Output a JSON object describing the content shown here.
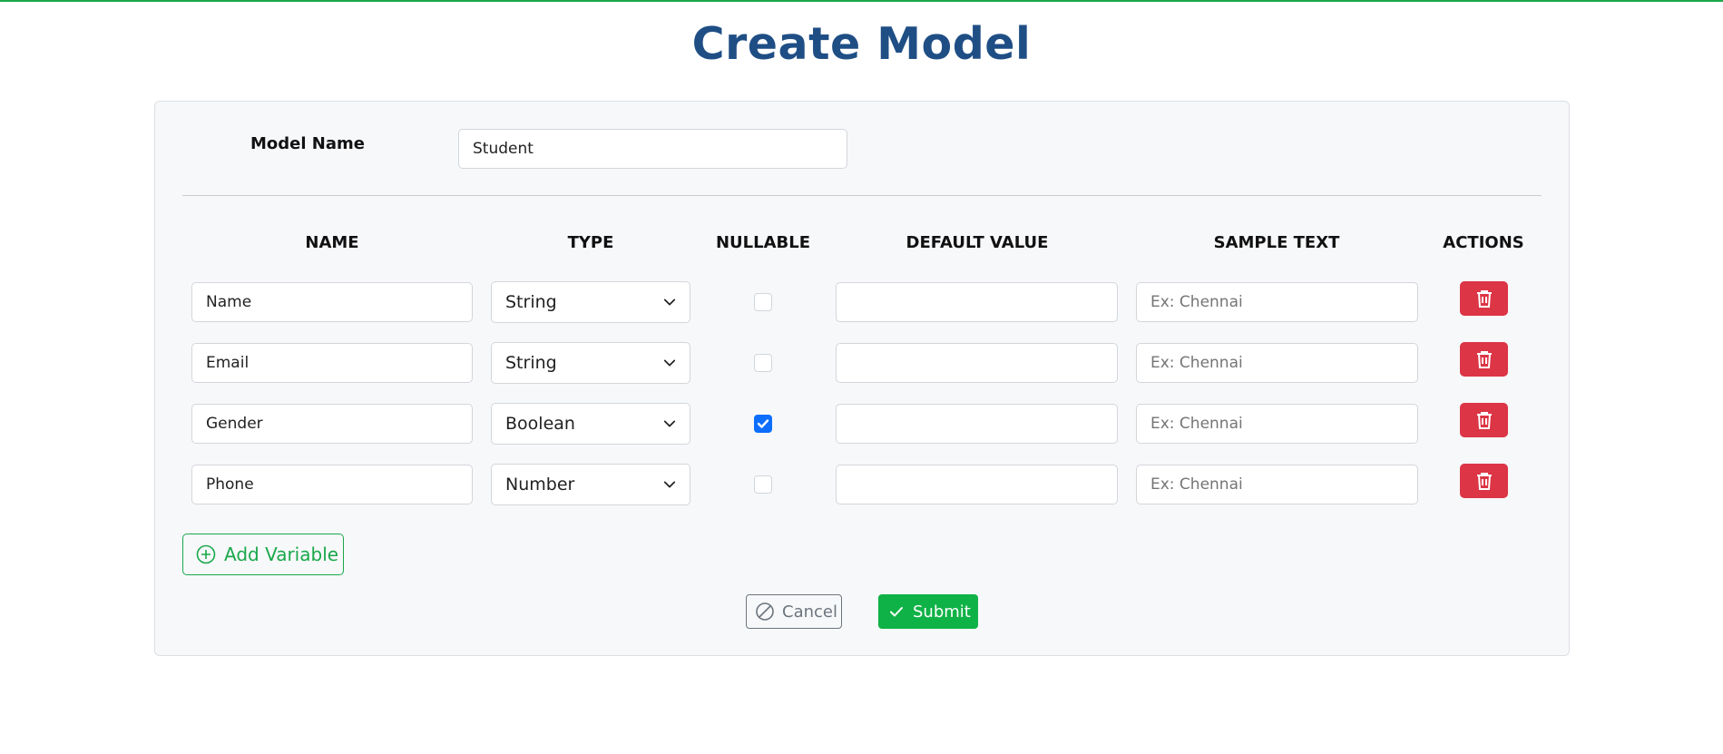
{
  "page": {
    "title": "Create Model"
  },
  "model": {
    "label": "Model Name",
    "value": "Student"
  },
  "columns": {
    "name": "NAME",
    "type": "TYPE",
    "nullable": "NULLABLE",
    "default_value": "DEFAULT VALUE",
    "sample_text": "SAMPLE TEXT",
    "actions": "ACTIONS"
  },
  "rows": [
    {
      "name": "Name",
      "type": "String",
      "nullable": false,
      "default_value": "",
      "sample_placeholder": "Ex: Chennai"
    },
    {
      "name": "Email",
      "type": "String",
      "nullable": false,
      "default_value": "",
      "sample_placeholder": "Ex: Chennai"
    },
    {
      "name": "Gender",
      "type": "Boolean",
      "nullable": true,
      "default_value": "",
      "sample_placeholder": "Ex: Chennai"
    },
    {
      "name": "Phone",
      "type": "Number",
      "nullable": false,
      "default_value": "",
      "sample_placeholder": "Ex: Chennai"
    }
  ],
  "buttons": {
    "add_variable": "Add Variable",
    "cancel": "Cancel",
    "submit": "Submit"
  },
  "icons": {
    "add": "plus-circle-icon",
    "cancel": "slash-circle-icon",
    "submit": "check-icon",
    "delete": "trash-icon",
    "select": "chevron-down-icon"
  },
  "colors": {
    "title": "#1f4e85",
    "success": "#1aa84a",
    "submit": "#0fb246",
    "danger": "#dc3545",
    "checked": "#0d6efd",
    "cancel": "#6c757d"
  }
}
